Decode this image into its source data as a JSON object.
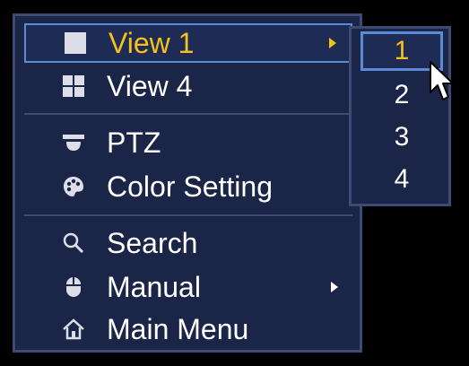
{
  "menu": {
    "items": [
      {
        "label": "View 1",
        "icon": "single-view-icon",
        "has_submenu": true,
        "selected": true
      },
      {
        "label": "View 4",
        "icon": "quad-view-icon",
        "has_submenu": false,
        "selected": false
      },
      {
        "label": "PTZ",
        "icon": "dome-camera-icon",
        "has_submenu": false,
        "selected": false
      },
      {
        "label": "Color Setting",
        "icon": "palette-icon",
        "has_submenu": false,
        "selected": false
      },
      {
        "label": "Search",
        "icon": "search-icon",
        "has_submenu": false,
        "selected": false
      },
      {
        "label": "Manual",
        "icon": "mouse-icon",
        "has_submenu": true,
        "selected": false
      },
      {
        "label": "Main Menu",
        "icon": "home-icon",
        "has_submenu": false,
        "selected": false
      }
    ]
  },
  "submenu": {
    "items": [
      {
        "label": "1",
        "selected": true
      },
      {
        "label": "2",
        "selected": false
      },
      {
        "label": "3",
        "selected": false
      },
      {
        "label": "4",
        "selected": false
      }
    ]
  },
  "colors": {
    "panel_bg": "#1b2547",
    "border": "#3d4a73",
    "highlight_border": "#5b8ad6",
    "selected_text": "#f4c21a",
    "text": "#ffffff"
  }
}
